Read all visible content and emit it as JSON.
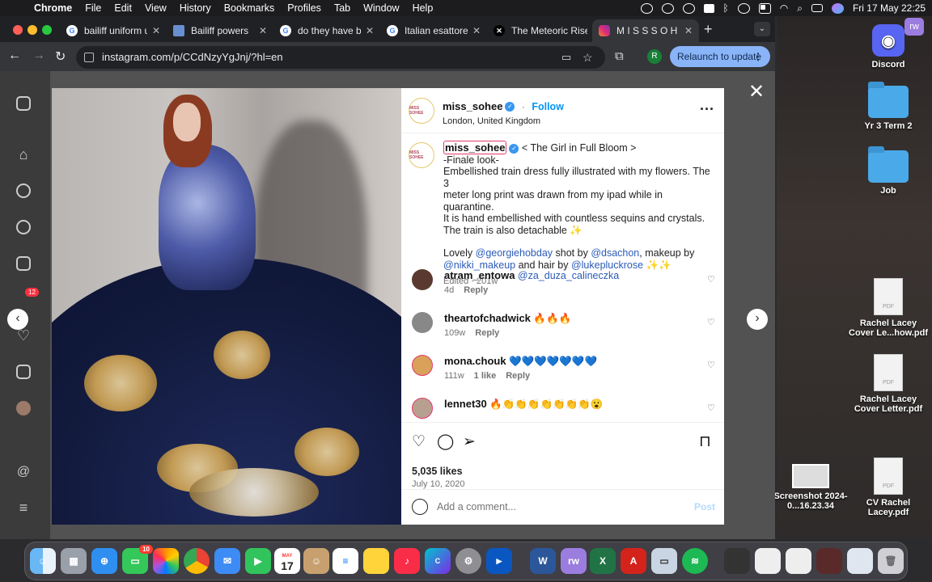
{
  "menubar": {
    "app": "Chrome",
    "menus": [
      "File",
      "Edit",
      "View",
      "History",
      "Bookmarks",
      "Profiles",
      "Tab",
      "Window",
      "Help"
    ],
    "clock": "Fri 17 May  22:25"
  },
  "tabs": [
    {
      "label": "bailiff uniform uk",
      "active": false
    },
    {
      "label": "Bailiff powers",
      "active": false
    },
    {
      "label": "do they have bailiffs",
      "active": false
    },
    {
      "label": "Italian esattore",
      "active": false
    },
    {
      "label": "The Meteoric Rise",
      "active": false
    },
    {
      "label": "M I S S S O H E E",
      "active": true
    }
  ],
  "toolbar": {
    "url": "instagram.com/p/CCdNzyYgJnj/?hl=en",
    "profile_initial": "R",
    "relaunch_label": "Relaunch to update"
  },
  "sidebar": {
    "notification_count": "12"
  },
  "post": {
    "username": "miss_sohee",
    "follow_label": "Follow",
    "location": "London, United Kingdom",
    "avatar_text": "MISS SOHEE",
    "caption_title": "< The Girl in Full Bloom >",
    "caption_lines": [
      "-Finale look-",
      "Embellished train dress fully illustrated with my flowers. The 3",
      "meter long print was drawn from my ipad while in quarantine.",
      "It is hand embellished with countless sequins and crystals.",
      "The train is also detachable ✨"
    ],
    "credits": {
      "lovely": "Lovely",
      "georgie": "@georgiehobday",
      "shot_by": "shot by",
      "dsachon": "@dsachon",
      "makeup_by": ", makeup by",
      "nikki": "@nikki_makeup",
      "hair_by": "and hair by",
      "luke": "@lukepluckrose",
      "sparkles": "✨✨"
    },
    "edited": "Edited · 201w",
    "likes": "5,035 likes",
    "date": "July 10, 2020",
    "comment_placeholder": "Add a comment...",
    "post_button": "Post"
  },
  "comments": [
    {
      "user": "atram_entowa",
      "text": "@za_duza_calineczka",
      "age": "4d",
      "likes": "",
      "reply": "Reply"
    },
    {
      "user": "theartofchadwick",
      "text": "🔥🔥🔥",
      "age": "109w",
      "likes": "",
      "reply": "Reply"
    },
    {
      "user": "mona.chouk",
      "text": "💙💙💙💙💙💙💙",
      "age": "111w",
      "likes": "1 like",
      "reply": "Reply"
    },
    {
      "user": "lennet30",
      "text": "🔥👏👏👏👏👏👏👏😮",
      "age": "",
      "likes": "",
      "reply": ""
    }
  ],
  "desktop": [
    {
      "name": "Discord"
    },
    {
      "name": "Yr 3 Term 2"
    },
    {
      "name": "Job"
    },
    {
      "name": "Rachel Lacey Cover Le...how.pdf"
    },
    {
      "name": "Rachel Lacey Cover Letter.pdf"
    },
    {
      "name": "Screenshot 2024-0...16.23.34"
    },
    {
      "name": "CV Rachel Lacey.pdf"
    }
  ],
  "dock": {
    "messages_badge": "10",
    "calendar_month": "MAY",
    "calendar_day": "17"
  }
}
